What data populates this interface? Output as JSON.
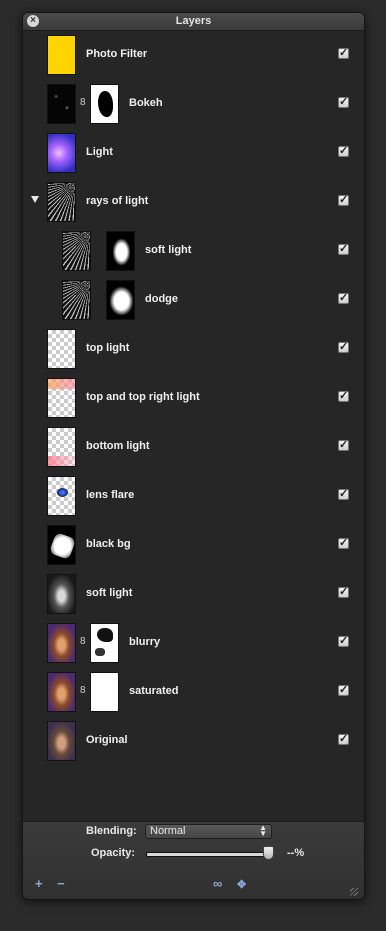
{
  "panel": {
    "title": "Layers",
    "close_icon": "close-icon"
  },
  "layers": [
    {
      "name": "Photo Filter",
      "visible": true,
      "checkmark": "✓"
    },
    {
      "name": "Bokeh",
      "visible": true,
      "checkmark": "✓"
    },
    {
      "name": "Light",
      "visible": true,
      "checkmark": "✓"
    },
    {
      "name": "rays of light",
      "visible": true,
      "checkmark": "✓"
    },
    {
      "name": "soft light",
      "visible": true,
      "checkmark": "✓"
    },
    {
      "name": "dodge",
      "visible": true,
      "checkmark": "✓"
    },
    {
      "name": "top light",
      "visible": true,
      "checkmark": "✓"
    },
    {
      "name": "top and top right light",
      "visible": true,
      "checkmark": "✓"
    },
    {
      "name": "bottom light",
      "visible": true,
      "checkmark": "✓"
    },
    {
      "name": "lens flare",
      "visible": true,
      "checkmark": "✓"
    },
    {
      "name": "black bg",
      "visible": true,
      "checkmark": "✓"
    },
    {
      "name": "soft light",
      "visible": true,
      "checkmark": "✓"
    },
    {
      "name": "blurry",
      "visible": true,
      "checkmark": "✓"
    },
    {
      "name": "saturated",
      "visible": true,
      "checkmark": "✓"
    },
    {
      "name": "Original",
      "visible": true,
      "checkmark": "✓"
    }
  ],
  "footer": {
    "blending_label": "Blending:",
    "blending_value": "Normal",
    "opacity_label": "Opacity:",
    "opacity_value": "--%",
    "add_glyph": "+",
    "remove_glyph": "−",
    "link_glyph": "∞",
    "move_glyph": "✥"
  },
  "colors": {
    "panel_bg": "#262626",
    "photo_filter_fill": "#ffd400"
  }
}
